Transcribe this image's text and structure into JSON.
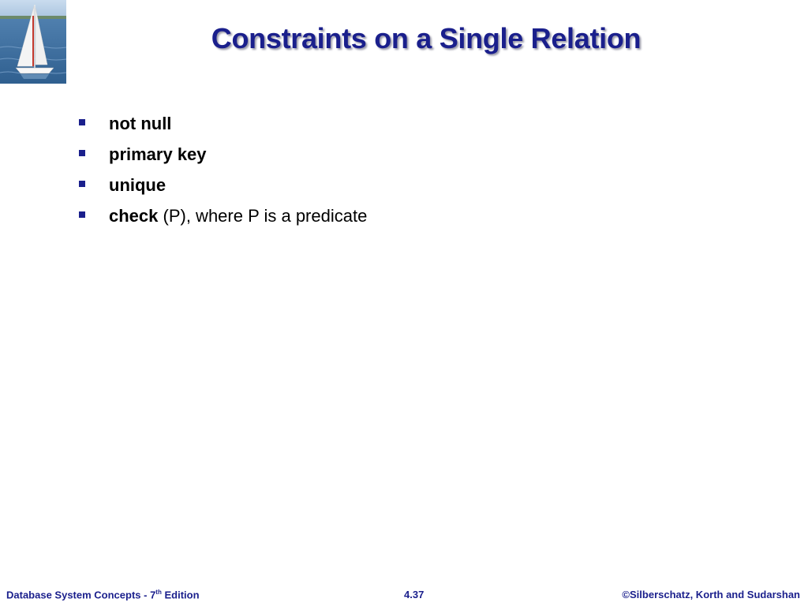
{
  "slide": {
    "title": "Constraints on a Single Relation",
    "bullets": [
      {
        "keyword": "not null",
        "rest": ""
      },
      {
        "keyword": "primary key",
        "rest": ""
      },
      {
        "keyword": "unique",
        "rest": ""
      },
      {
        "keyword": "check",
        "rest": " (P), where P is a predicate"
      }
    ]
  },
  "footer": {
    "book_prefix": "Database System Concepts - 7",
    "book_sup": "th",
    "book_suffix": " Edition",
    "page_number": "4.37",
    "copyright": "©Silberschatz, Korth and Sudarshan"
  },
  "logo": {
    "icon": "sailboat-image"
  },
  "colors": {
    "title": "#1a1f8c",
    "bullet": "#1a1f8c",
    "footer": "#1a1f8c"
  }
}
